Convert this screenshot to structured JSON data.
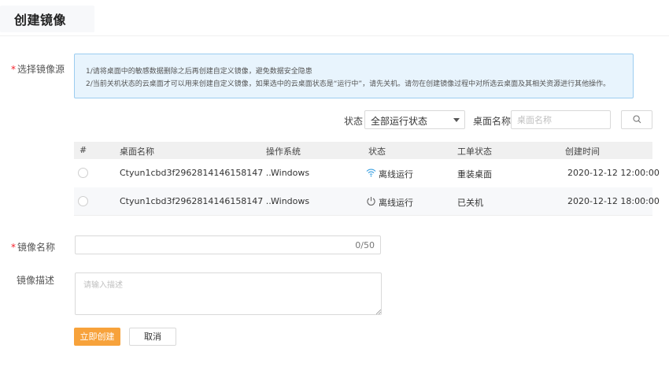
{
  "header": {
    "title": "创建镜像"
  },
  "form": {
    "source_label": "选择镜像源",
    "name_label": "镜像名称",
    "desc_label": "镜像描述",
    "required_mark": "*"
  },
  "notice": {
    "lines": [
      "1/请将桌面中的敏感数据删除之后再创建自定义镜像，避免数据安全隐患",
      "2/当前关机状态的云桌面才可以用来创建自定义镜像，如果选中的云桌面状态是“运行中”，请先关机。请勿在创建镜像过程中对所选云桌面及其相关资源进行其他操作。"
    ]
  },
  "filter": {
    "status_label": "状态",
    "status_value": "全部运行状态",
    "name_label": "桌面名称",
    "name_placeholder": "桌面名称"
  },
  "table": {
    "headers": [
      "#",
      "桌面名称",
      "操作系统",
      "状态",
      "工单状态",
      "创建时间"
    ],
    "rows": [
      {
        "name": "Ctyun1cbd3f2962814146158147 ...",
        "os": "Windows",
        "status": "离线运行",
        "status_icon": "wifi-icon",
        "ticket": "重装桌面",
        "created": "2020-12-12 12:00:00"
      },
      {
        "name": "Ctyun1cbd3f2962814146158147 ...",
        "os": "Windows",
        "status": "离线运行",
        "status_icon": "power-icon",
        "ticket": "已关机",
        "created": "2020-12-12 18:00:00"
      }
    ]
  },
  "image_name": {
    "value": "",
    "counter": "0/50"
  },
  "description": {
    "placeholder": "请输入描述"
  },
  "actions": {
    "create": "立即创建",
    "cancel": "取消"
  },
  "colors": {
    "primary": "#f7a23b",
    "notice_bg": "#e8f4fd",
    "notice_border": "#9ccdf0",
    "required": "#f5222d"
  }
}
